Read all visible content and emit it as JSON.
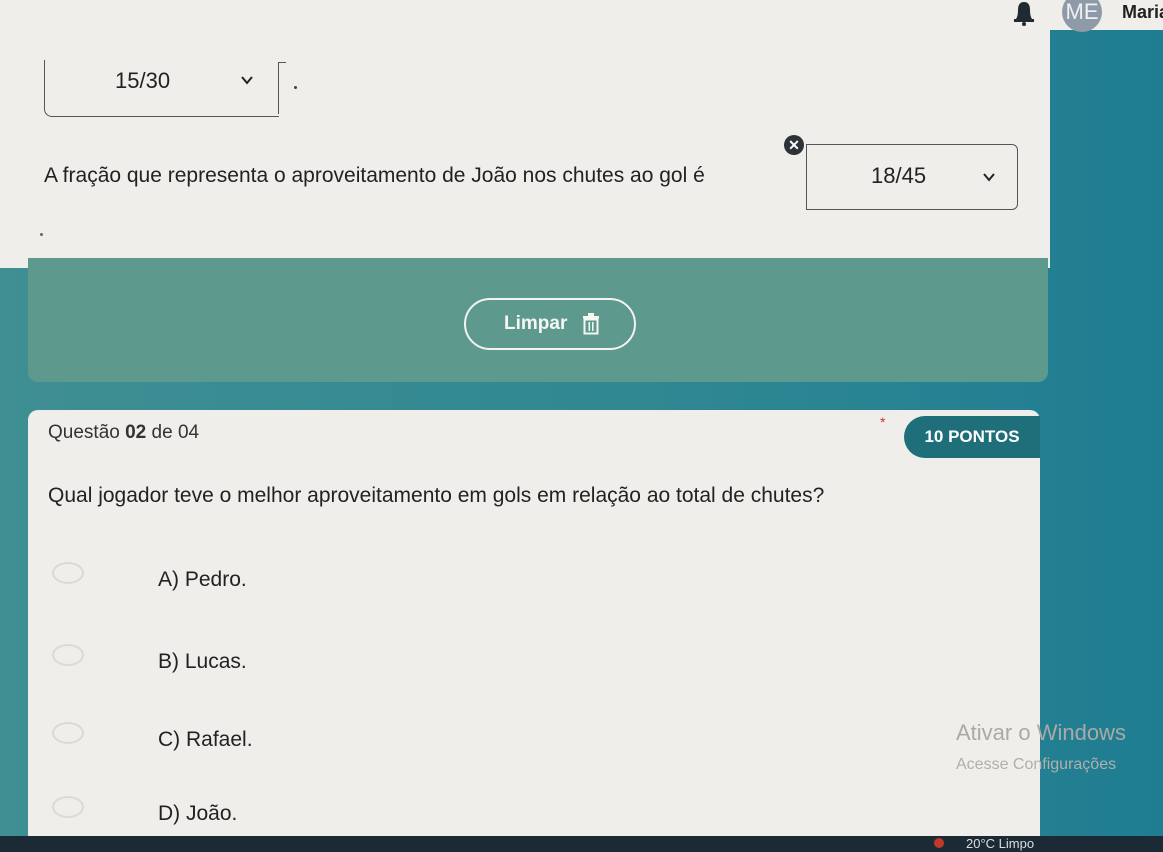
{
  "topbar": {
    "avatar_initials": "ME",
    "user_name": "Maria"
  },
  "previous_question": {
    "selected_answer_1": "15/30",
    "statement": "A fração que representa o aproveitamento de João nos chutes ao gol é",
    "selected_answer_2": "18/45",
    "clear_label": "Limpar"
  },
  "question": {
    "counter_prefix": "Questão ",
    "counter_number": "02",
    "counter_suffix": " de 04",
    "required_mark": "*",
    "points": "10 PONTOS",
    "text": "Qual jogador teve o melhor aproveitamento em gols em relação ao total de chutes?",
    "options": [
      {
        "label": "A) Pedro."
      },
      {
        "label": "B) Lucas."
      },
      {
        "label": "C) Rafael."
      },
      {
        "label": "D) João."
      }
    ]
  },
  "watermark": {
    "line1": "Ativar o Windows",
    "line2": "Acesse Configurações"
  },
  "taskbar": {
    "weather": "20°C Limpo"
  },
  "colors": {
    "page_background": "#2d8a93",
    "card_background": "#efeeea",
    "teal_panel": "#5d9a8d",
    "points_badge": "#1e6f7a"
  }
}
